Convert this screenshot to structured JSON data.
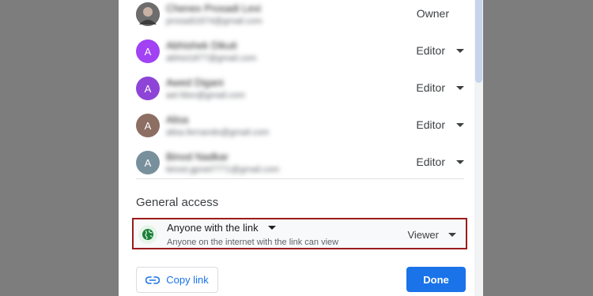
{
  "people": [
    {
      "initial": "",
      "name": "Chenex Prosadi Lexi",
      "email": "prosadi1874@gmail.com",
      "role": "Owner",
      "avatar_color": "#5f6368",
      "has_dropdown": false
    },
    {
      "initial": "A",
      "name": "Abhishek Dikuti",
      "email": "abhixi1877@gmail.com",
      "role": "Editor",
      "avatar_color": "#a142f4",
      "has_dropdown": true
    },
    {
      "initial": "A",
      "name": "Awed Digani",
      "email": "ael.fdsn@gmail.com",
      "role": "Editor",
      "avatar_color": "#8e44d6",
      "has_dropdown": true
    },
    {
      "initial": "A",
      "name": "Alisa",
      "email": "alisa.fernando@gmail.com",
      "role": "Editor",
      "avatar_color": "#8d6e63",
      "has_dropdown": true
    },
    {
      "initial": "A",
      "name": "Binod Nadkar",
      "email": "binod.gpnet7771@gmail.com",
      "role": "Editor",
      "avatar_color": "#78909c",
      "has_dropdown": true
    }
  ],
  "general_access": {
    "title": "General access",
    "scope": "Anyone with the link",
    "description": "Anyone on the internet with the link can view",
    "role": "Viewer"
  },
  "buttons": {
    "copy_link": "Copy link",
    "done": "Done"
  },
  "colors": {
    "accent": "#1a73e8",
    "highlight_border": "#9b1b1b",
    "globe": "#188038"
  }
}
